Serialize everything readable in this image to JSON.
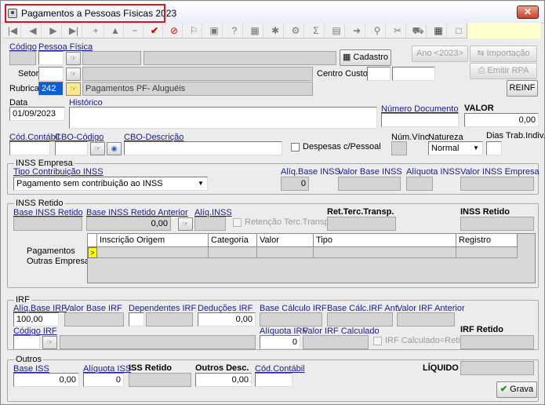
{
  "window": {
    "title": "Pagamentos a Pessoas Físicas 2023",
    "close_label": "✕"
  },
  "toolbar": {
    "icons": [
      "first-icon",
      "prev-icon",
      "next-icon",
      "last-icon",
      "add-icon",
      "up-icon",
      "delete-icon",
      "confirm-icon",
      "cancel-icon",
      "flag-icon",
      "folder-icon",
      "help-icon",
      "grid-tool-icon",
      "refresh-icon",
      "settings-icon",
      "sum-icon",
      "document-icon",
      "export-icon",
      "search-icon",
      "tools-icon",
      "car-icon",
      "calendar-icon",
      "close-panel-icon"
    ]
  },
  "header": {
    "codigo_label": "Código",
    "pessoa_fisica_label": "Pessoa Física",
    "cadastro_label": "Cadastro",
    "ano_label": "Ano <2023>",
    "importacao_label": "Importação",
    "emitir_rpa_label": "Emitir RPA",
    "reinf_label": "REINF",
    "setor_label": "Setor",
    "centro_custos_label": "Centro Custos",
    "rubrica_label": "Rubrica",
    "rubrica_code": "242",
    "rubrica_desc": "Pagamentos PF- Aluguéis",
    "data_label": "Data",
    "data_value": "01/09/2023",
    "historico_label": "Histórico",
    "numero_documento_label": "Número Documento",
    "valor_label": "VALOR",
    "valor_value": "0,00",
    "cod_contabil_label": "Cód.Contábil",
    "cbo_codigo_label": "CBO-Código",
    "cbo_descricao_label": "CBO-Descrição",
    "despesas_pessoal_label": "Despesas c/Pessoal",
    "num_vinc_label": "Núm.Vínc",
    "natureza_label": "Natureza",
    "natureza_value": "Normal",
    "dias_trab_label": "Dias Trab.Indiv."
  },
  "inss_empresa": {
    "title": "INSS Empresa",
    "tipo_label": "Tipo Contribuição INSS",
    "tipo_value": "Pagamento sem contribuição ao INSS",
    "aliq_base_label": "Alíq.Base INSS",
    "aliq_base_value": "0",
    "valor_base_label": "Valor Base INSS",
    "aliquota_label": "Alíquota INSS",
    "valor_empresa_label": "Valor INSS Empresa"
  },
  "inss_retido": {
    "title": "INSS Retido",
    "base_label": "Base INSS Retido",
    "base_anterior_label": "Base INSS Retido Anterior",
    "base_anterior_value": "0,00",
    "aliq_label": "Alíq.INSS",
    "retencao_label": "Retenção Terc.Transp.",
    "ret_terc_label": "Ret.Terc.Transp.",
    "inss_retido_label": "INSS Retido",
    "pagamentos_label_1": "Pagamentos",
    "pagamentos_label_2": "Outras Empresas",
    "columns": [
      "Inscrição Origem",
      "Categoria",
      "Valor",
      "Tipo",
      "Registro"
    ],
    "row_indicator": ">"
  },
  "irf": {
    "title": "IRF",
    "aliq_base_label": "Alíq.Base IRF",
    "aliq_base_value": "100,00",
    "valor_base_label": "Valor Base IRF",
    "dependentes_label": "Dependentes IRF",
    "deducoes_label": "Deduções IRF",
    "deducoes_value": "0,00",
    "base_calculo_label": "Base Cálculo IRF",
    "base_calc_ant_label": "Base Cálc.IRF Ant.",
    "valor_anterior_label": "Valor IRF Anterior",
    "codigo_label": "Código IRF",
    "aliquota_label": "Alíquota IRF",
    "aliquota_value": "0",
    "valor_calculado_label": "Valor IRF Calculado",
    "calculado_retido_label": "IRF Calculado=Retido",
    "irf_retido_label": "IRF Retido"
  },
  "outros": {
    "title": "Outros",
    "base_iss_label": "Base ISS",
    "base_iss_value": "0,00",
    "aliquota_iss_label": "Alíquota ISS",
    "aliquota_iss_value": "0",
    "iss_retido_label": "ISS Retido",
    "outros_desc_label": "Outros Desc.",
    "outros_desc_value": "0,00",
    "cod_contabil_label": "Cód.Contábil",
    "liquido_label": "LÍQUIDO",
    "grava_label": "Grava"
  }
}
